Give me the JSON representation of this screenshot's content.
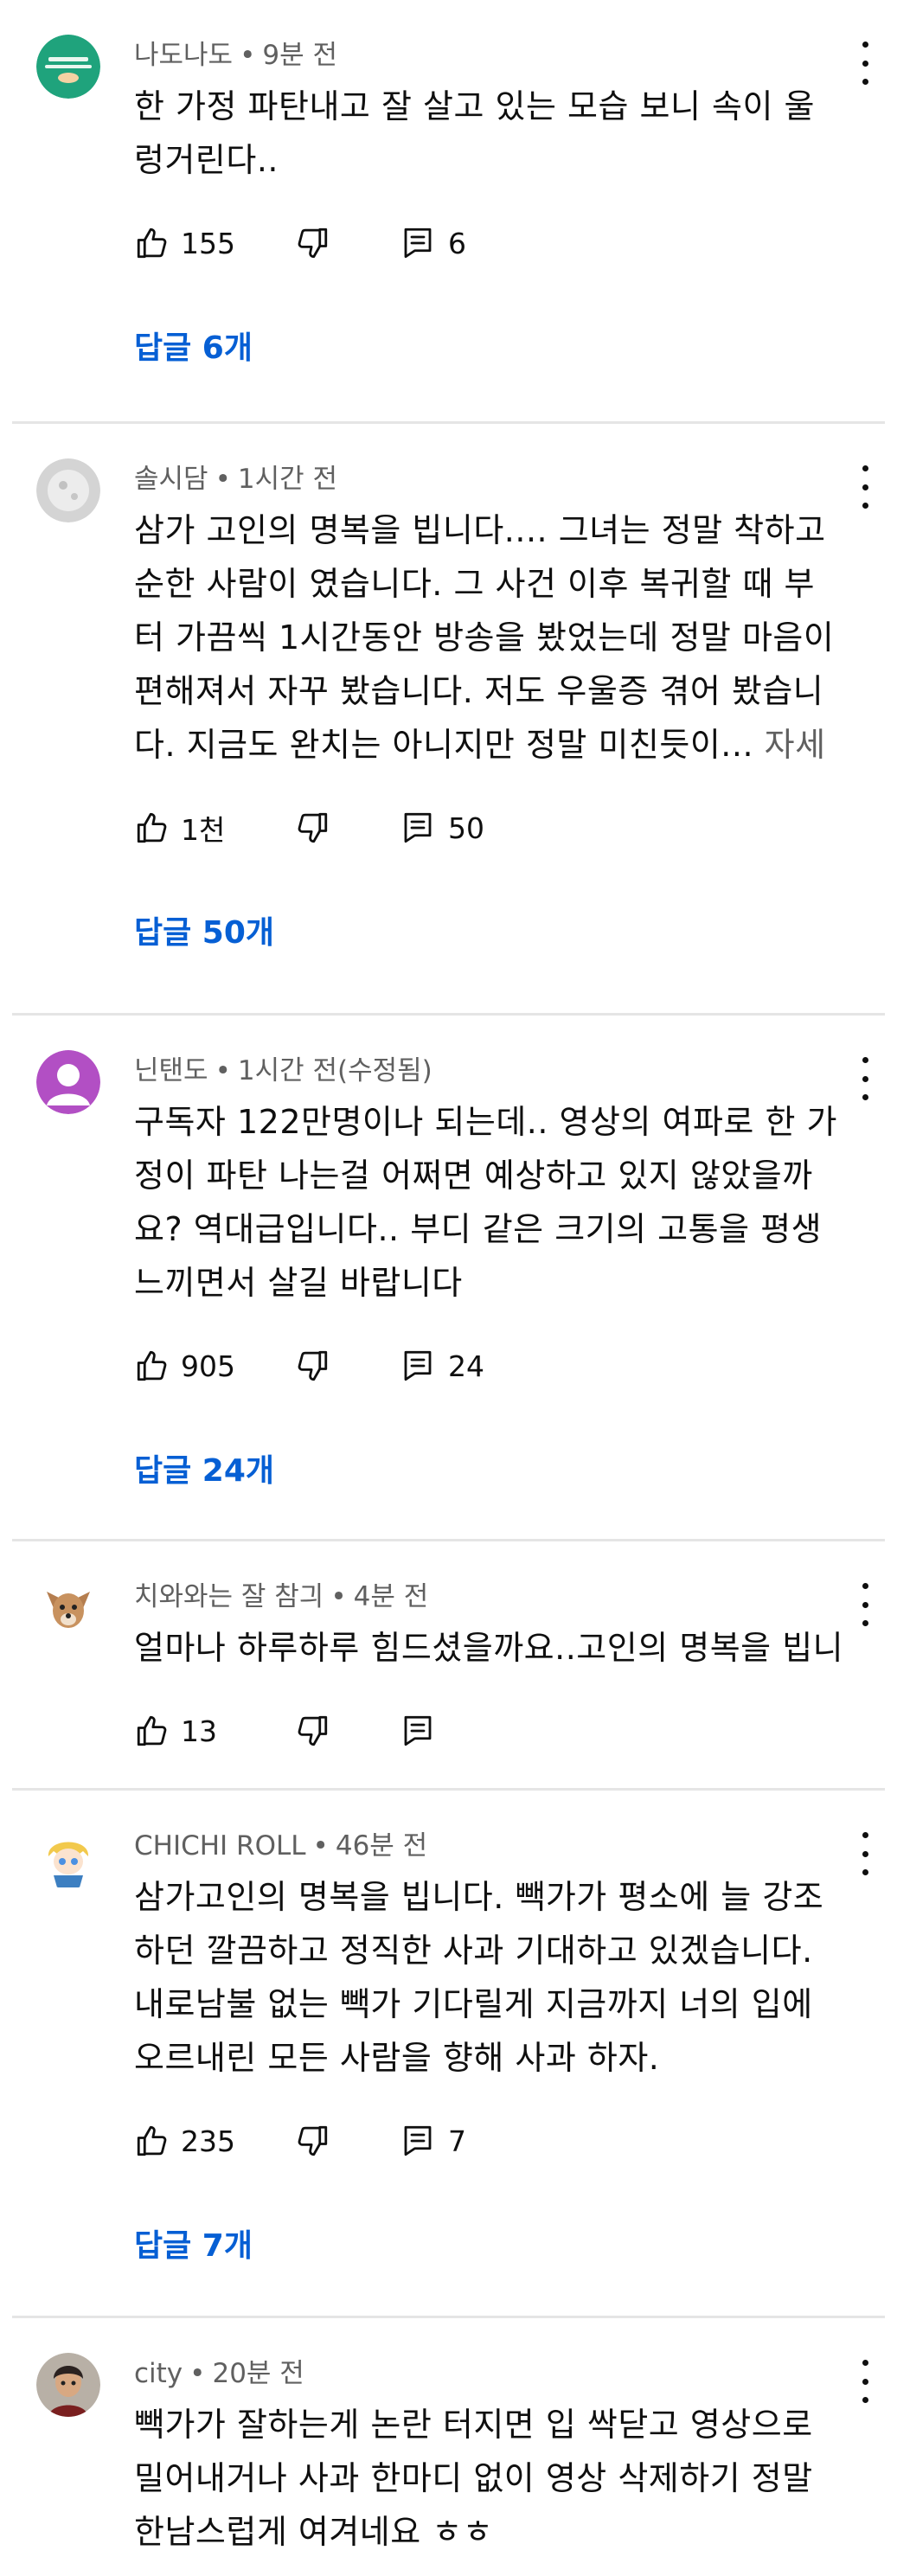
{
  "accent_link_color": "#065fd4",
  "meta_separator": "•",
  "comments": [
    {
      "author": "나도나도",
      "time": "9분 전",
      "edited": "",
      "text": "한 가정 파탄내고 잘 살고 있는 모습 보니 속이 울렁거린다..",
      "more": "",
      "likes": "155",
      "reply_count": "6",
      "replies_link": "답글 6개",
      "avatar_icon": "green-badge-avatar-icon"
    },
    {
      "author": "솔시담",
      "time": "1시간 전",
      "edited": "",
      "text": "삼가 고인의 명복을 빕니다.... 그녀는 정말 착하고 순한 사람이 였습니다. 그 사건 이후 복귀할 때 부터 가끔씩 1시간동안 방송을 봤었는데 정말 마음이 편해져서 자꾸 봤습니다. 저도 우울증 겪어 봤습니다. 지금도 완치는 아니지만 정말 미친듯이...",
      "more": "자세히 보기",
      "likes": "1천",
      "reply_count": "50",
      "replies_link": "답글 50개",
      "avatar_icon": "grey-moon-avatar-icon"
    },
    {
      "author": "닌탠도",
      "time": "1시간 전",
      "edited": "(수정됨)",
      "text": "구독자 122만명이나 되는데.. 영상의 여파로 한 가정이 파탄 나는걸 어쩌면 예상하고 있지 않았을까요? 역대급입니다.. 부디 같은 크기의 고통을 평생 느끼면서 살길 바랍니다",
      "more": "",
      "likes": "905",
      "reply_count": "24",
      "replies_link": "답글 24개",
      "avatar_icon": "default-person-avatar-icon"
    },
    {
      "author": "치와와는 잘 참긔",
      "time": "4분 전",
      "edited": "",
      "text": "얼마나 하루하루 힘드셨을까요..고인의 명복을 빕니다",
      "more": "",
      "likes": "13",
      "reply_count": "",
      "replies_link": "",
      "avatar_icon": "dog-avatar-icon"
    },
    {
      "author": "CHICHI ROLL",
      "time": "46분 전",
      "edited": "",
      "text": "삼가고인의 명복을 빕니다. 빽가가 평소에 늘 강조하던 깔끔하고 정직한 사과 기대하고 있겠습니다. 내로남불 없는 빽가 기다릴게 지금까지 너의 입에 오르내린 모든 사람을 향해 사과 하자.",
      "more": "",
      "likes": "235",
      "reply_count": "7",
      "replies_link": "답글 7개",
      "avatar_icon": "anime-character-avatar-icon"
    },
    {
      "author": "city",
      "time": "20분 전",
      "edited": "",
      "text": "빽가가 잘하는게 논란 터지면 입 싹닫고 영상으로 밀어내거나 사과 한마디 없이 영상 삭제하기 정말 한남스럽게 여겨네요 ㅎㅎ",
      "more": "",
      "likes": "",
      "reply_count": "",
      "replies_link": "",
      "avatar_icon": "person-photo-avatar-icon"
    }
  ]
}
